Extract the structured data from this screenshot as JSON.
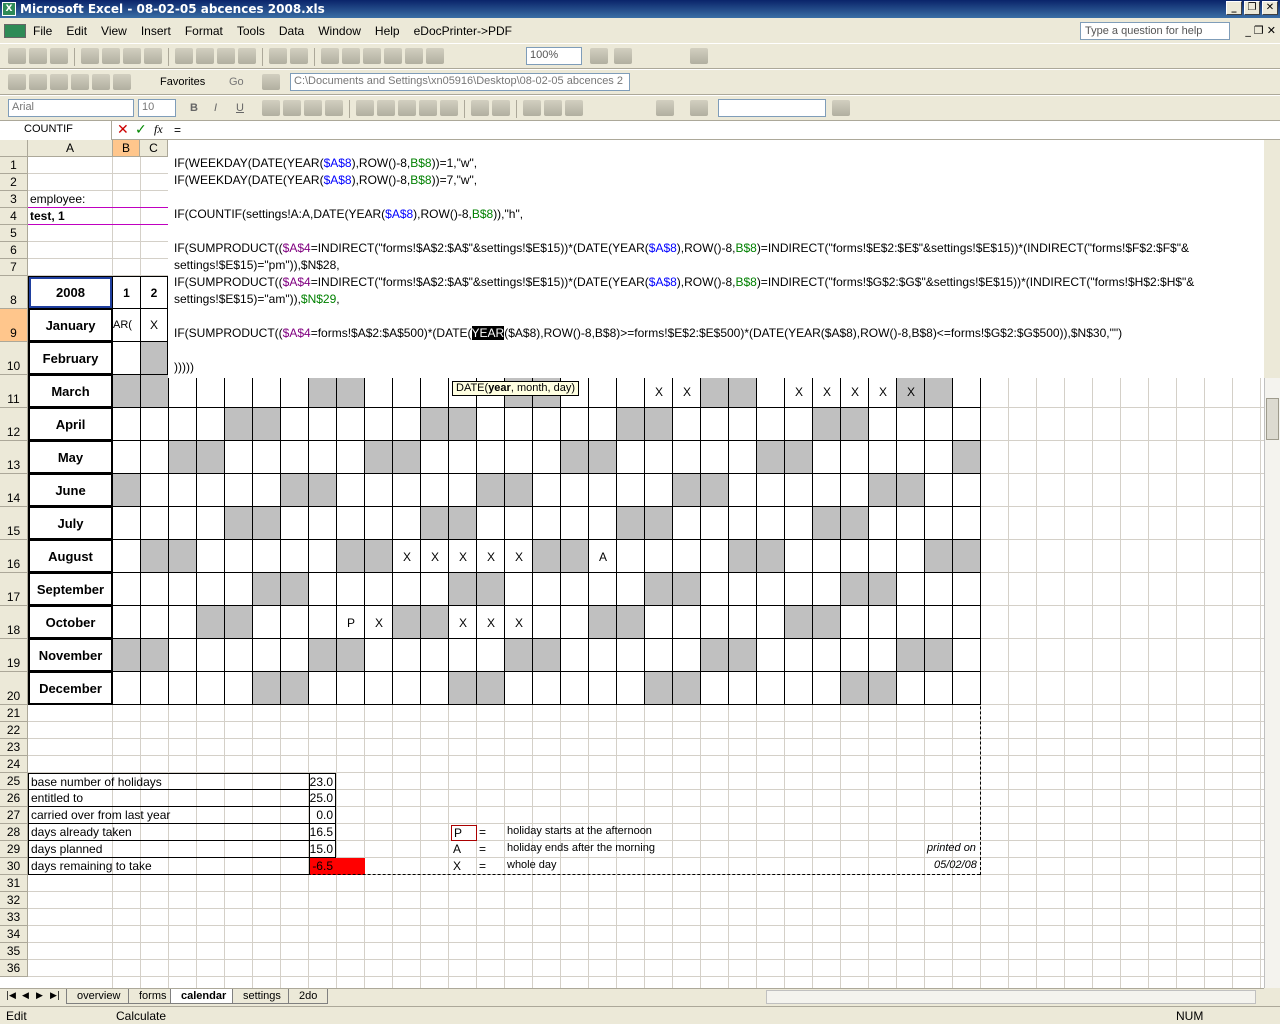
{
  "window": {
    "title": "Microsoft Excel - 08-02-05 abcences 2008.xls",
    "help_placeholder": "Type a question for help"
  },
  "menu": [
    "File",
    "Edit",
    "View",
    "Insert",
    "Format",
    "Tools",
    "Data",
    "Window",
    "Help",
    "eDocPrinter->PDF"
  ],
  "toolbar": {
    "zoom": "100%",
    "favorites_label": "Favorites",
    "go_label": "Go",
    "address": "C:\\Documents and Settings\\xn05916\\Desktop\\08-02-05 abcences 2",
    "font_name": "Arial",
    "font_size": "10",
    "bold": "B",
    "italic": "I",
    "underline": "U"
  },
  "formula_bar": {
    "name_box": "COUNTIF",
    "cancel_glyph": "✕",
    "enter_glyph": "✓",
    "fx_glyph": "fx",
    "content": "=",
    "lines": [
      "IF(WEEKDAY(DATE(YEAR($A$8),ROW()-8,B$8))=1,\"w\",",
      "IF(WEEKDAY(DATE(YEAR($A$8),ROW()-8,B$8))=7,\"w\",",
      "IF(COUNTIF(settings!A:A,DATE(YEAR($A$8),ROW()-8,B$8)),\"h\",",
      "IF(SUMPRODUCT(($A$4=INDIRECT(\"forms!$A$2:$A$\"&settings!$E$15))*(DATE(YEAR($A$8),ROW()-8,B$8)=INDIRECT(\"forms!$E$2:$E$\"&settings!$E$15))*(INDIRECT(\"forms!$F$2:$F$\"&",
      "settings!$E$15)=\"pm\")),$N$28,",
      "IF(SUMPRODUCT(($A$4=INDIRECT(\"forms!$A$2:$A$\"&settings!$E$15))*(DATE(YEAR($A$8),ROW()-8,B$8)=INDIRECT(\"forms!$G$2:$G$\"&settings!$E$15))*(INDIRECT(\"forms!$H$2:$H$\"&",
      "settings!$E$15)=\"am\")),$N$29,",
      "IF(SUMPRODUCT(($A$4=forms!$A$2:$A$500)*(DATE(YEAR($A$8),ROW()-8,B$8)>=forms!$E$2:$E$500)*(DATE(YEAR($A$8),ROW()-8,B$8)<=forms!$G$2:$G$500)),$N$30,\"\")",
      ")))))"
    ],
    "tooltip_prefix": "DATE(",
    "tooltip_bold": "year",
    "tooltip_suffix": ", month, day)"
  },
  "sheet": {
    "columns": [
      "A",
      "B",
      "C"
    ],
    "rows": [
      "1",
      "2",
      "3",
      "4",
      "5",
      "6",
      "7",
      "8",
      "9",
      "10",
      "11",
      "12",
      "13",
      "14",
      "15",
      "16",
      "17",
      "18",
      "19",
      "20",
      "21",
      "22",
      "23",
      "24",
      "25",
      "26",
      "27",
      "28",
      "29",
      "30",
      "31",
      "32",
      "33",
      "34",
      "35",
      "36"
    ],
    "employee_label": "employee:",
    "employee_name": "test, 1",
    "year": "2008",
    "day1": "1",
    "day2": "2",
    "b9_fragment": "AR(",
    "c9_mark": "X",
    "months": [
      "January",
      "February",
      "March",
      "April",
      "May",
      "June",
      "July",
      "August",
      "September",
      "October",
      "November",
      "December"
    ],
    "marks": {
      "march": [
        "X",
        "X",
        "X",
        "X",
        "X",
        "X",
        "X"
      ],
      "august": [
        "X",
        "X",
        "X",
        "X",
        "X",
        "A"
      ],
      "october": [
        "P",
        "X",
        "X",
        "X",
        "X"
      ]
    }
  },
  "summary": [
    {
      "label": "base number of holidays",
      "value": "23.0"
    },
    {
      "label": "entitled to",
      "value": "25.0"
    },
    {
      "label": "carried over from last year",
      "value": "0.0"
    },
    {
      "label": "days already taken",
      "value": "16.5"
    },
    {
      "label": "days planned",
      "value": "15.0"
    },
    {
      "label": "days remaining to take",
      "value": "-6.5"
    }
  ],
  "legend": [
    {
      "code": "P",
      "eq": "=",
      "desc": "holiday starts at the afternoon"
    },
    {
      "code": "A",
      "eq": "=",
      "desc": "holiday ends after the morning"
    },
    {
      "code": "X",
      "eq": "=",
      "desc": "whole day"
    }
  ],
  "printed": {
    "label": "printed on",
    "date": "05/02/08"
  },
  "tabs": [
    "overview",
    "forms",
    "calendar",
    "settings",
    "2do"
  ],
  "active_tab": "calendar",
  "status": {
    "mode": "Edit",
    "message": "Calculate",
    "num": "NUM"
  },
  "colors": {
    "negative_fill": "#ff0000",
    "weekend_fill": "#c0c0c0",
    "title_bar": "#0a246a"
  }
}
